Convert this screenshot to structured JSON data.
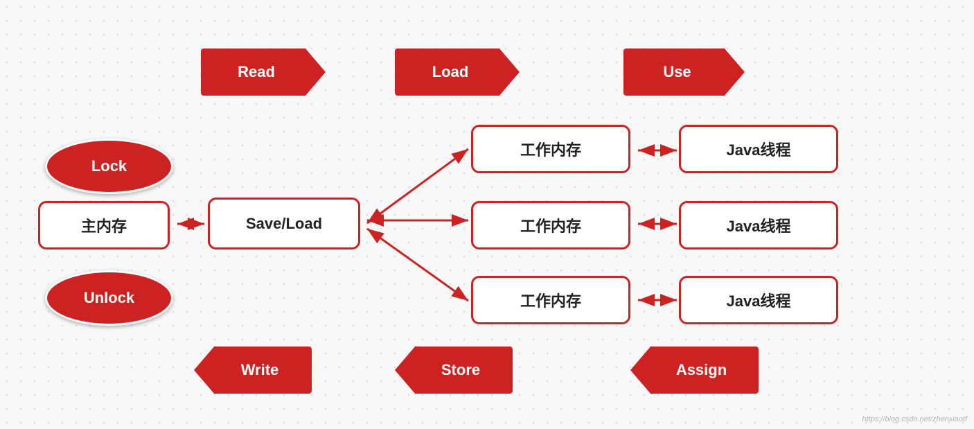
{
  "arrows": {
    "read_label": "Read",
    "load_label": "Load",
    "use_label": "Use",
    "write_label": "Write",
    "store_label": "Store",
    "assign_label": "Assign"
  },
  "ovals": {
    "lock_label": "Lock",
    "unlock_label": "Unlock"
  },
  "boxes": {
    "main_memory": "主内存",
    "save_load": "Save/Load",
    "work_mem1": "工作内存",
    "work_mem2": "工作内存",
    "work_mem3": "工作内存",
    "java_thread1": "Java线程",
    "java_thread2": "Java线程",
    "java_thread3": "Java线程"
  },
  "watermark": "https://blog.csdn.net/zhenxiaotf"
}
